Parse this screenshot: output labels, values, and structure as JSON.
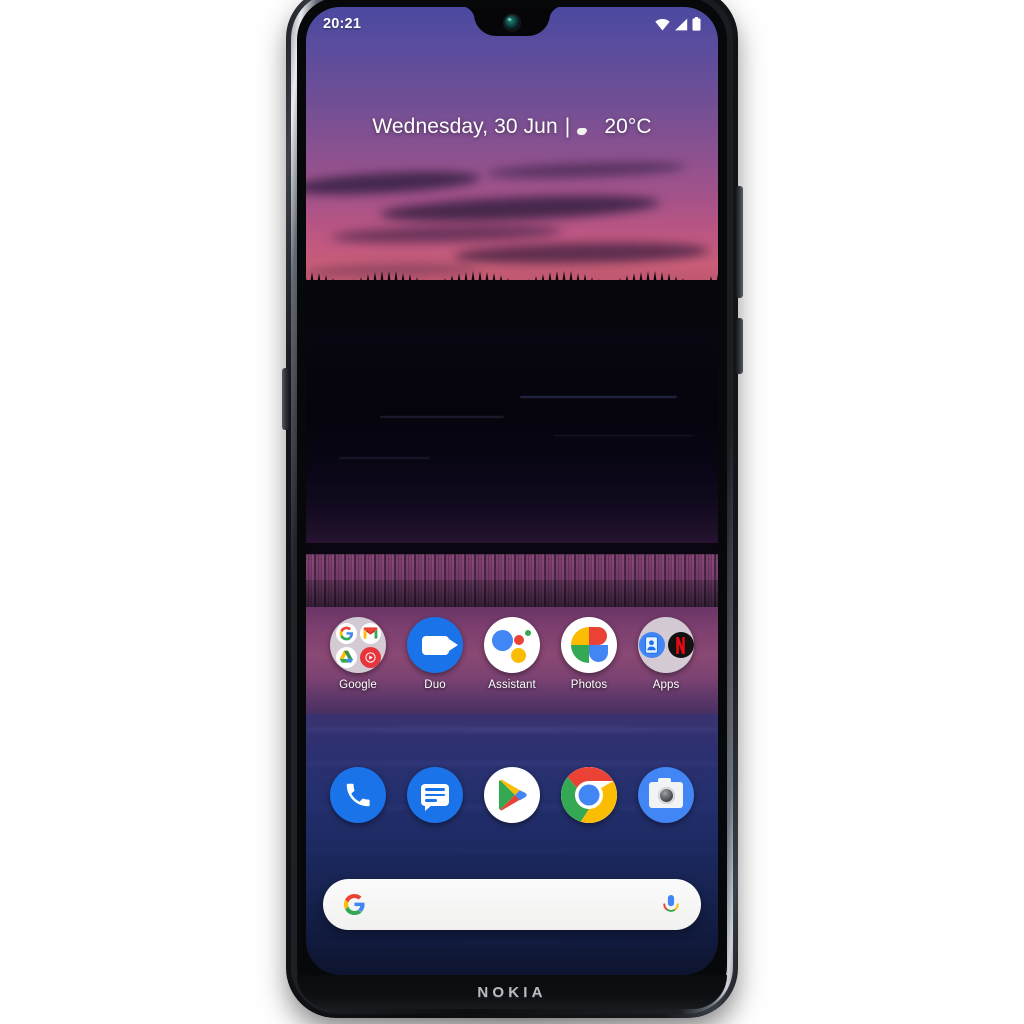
{
  "device": {
    "brand": "NOKIA",
    "brand_name": "nokia-logo"
  },
  "status_bar": {
    "time": "20:21",
    "icons": [
      "wifi-icon",
      "signal-icon",
      "battery-icon"
    ]
  },
  "widget": {
    "name": "date-weather-widget",
    "date_text": "Wednesday, 30 Jun",
    "separator": "|",
    "temperature": "20°C",
    "weather_icon": "sun-behind-cloud-icon"
  },
  "home_screen": {
    "app_row": [
      {
        "label": "Google",
        "icon": "google-folder-icon",
        "type": "folder"
      },
      {
        "label": "Duo",
        "icon": "duo-icon",
        "type": "app"
      },
      {
        "label": "Assistant",
        "icon": "assistant-icon",
        "type": "app"
      },
      {
        "label": "Photos",
        "icon": "photos-icon",
        "type": "app"
      },
      {
        "label": "Apps",
        "icon": "apps-folder-icon",
        "type": "folder"
      }
    ],
    "dock": [
      {
        "label": "Phone",
        "icon": "phone-icon"
      },
      {
        "label": "Messages",
        "icon": "messages-icon"
      },
      {
        "label": "Play Store",
        "icon": "play-store-icon"
      },
      {
        "label": "Chrome",
        "icon": "chrome-icon"
      },
      {
        "label": "Camera",
        "icon": "camera-icon"
      }
    ],
    "google_folder_apps": [
      "Google",
      "Gmail",
      "Drive",
      "YouTube Music"
    ],
    "apps_folder_apps": [
      "Contacts",
      "Netflix"
    ]
  },
  "search": {
    "name": "google-search-bar",
    "value": "",
    "placeholder": "",
    "left_icon": "google-g-icon",
    "right_icon": "microphone-icon"
  },
  "colors": {
    "google_blue": "#4285f4",
    "google_red": "#ea4335",
    "google_yellow": "#fbbc04",
    "google_green": "#34a853",
    "accent_blue": "#1a73e8",
    "netflix_red": "#e50914"
  }
}
